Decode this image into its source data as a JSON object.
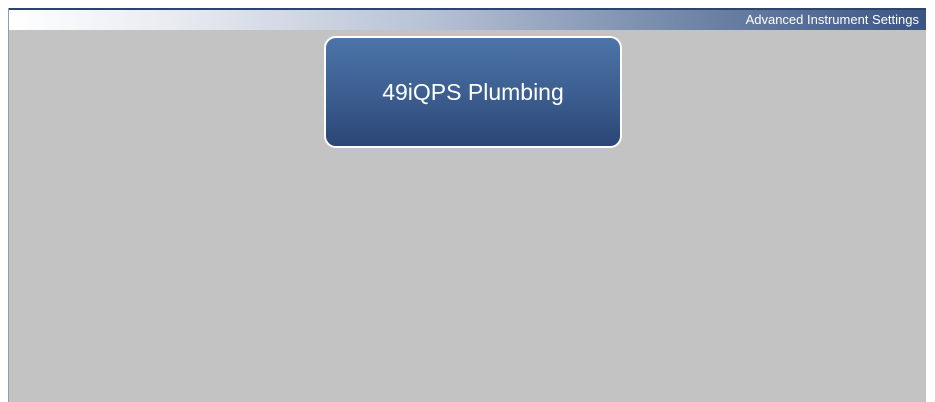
{
  "header": {
    "title": "Advanced Instrument Settings"
  },
  "menu": {
    "items": [
      {
        "label": "49iQPS Plumbing"
      }
    ]
  },
  "colors": {
    "background": "#c3c3c3",
    "header_dark": "#3c5482",
    "button_top": "#4c74a8",
    "button_bottom": "#2c4677",
    "button_border": "#ffffff",
    "text": "#ffffff"
  }
}
